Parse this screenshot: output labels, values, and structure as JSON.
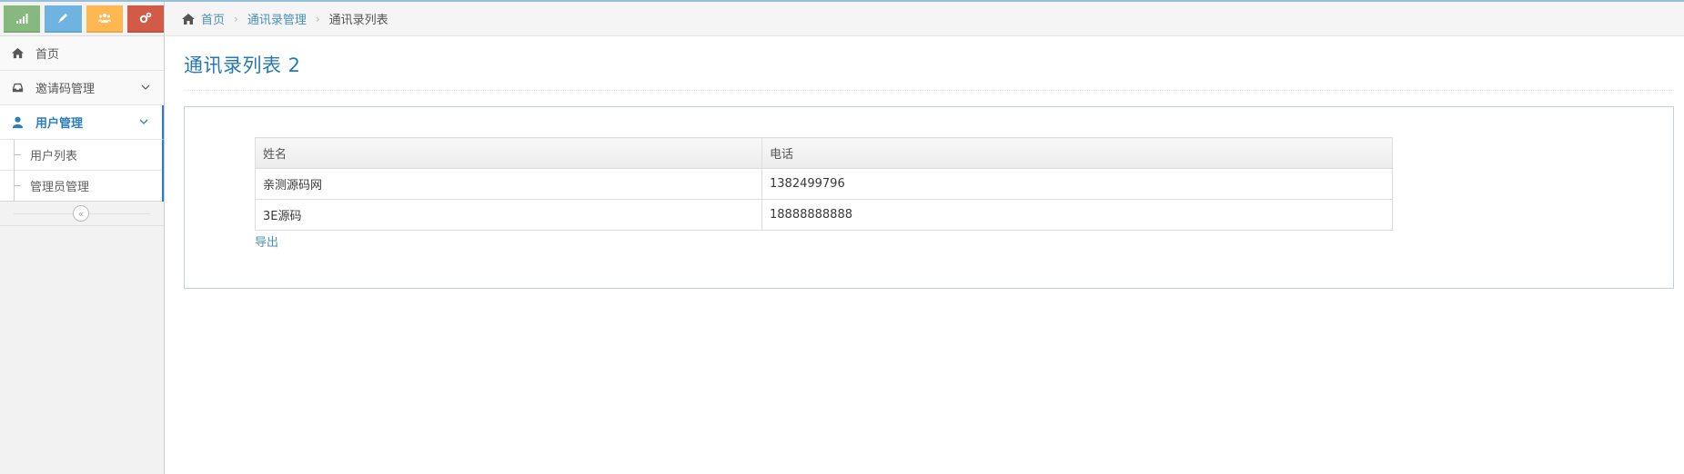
{
  "colors": {
    "accent": "#2679b5",
    "link": "#4c8fbd",
    "shortcut_green": "#87b87f",
    "shortcut_blue": "#6fb3e0",
    "shortcut_orange": "#ffb752",
    "shortcut_red": "#d15b47"
  },
  "shortcuts": [
    {
      "icon": "signal-icon",
      "color": "#87b87f"
    },
    {
      "icon": "pencil-icon",
      "color": "#6fb3e0"
    },
    {
      "icon": "group-icon",
      "color": "#ffb752"
    },
    {
      "icon": "cogs-icon",
      "color": "#d15b47"
    }
  ],
  "sidebar": {
    "items": [
      {
        "label": "首页",
        "icon": "home-icon"
      },
      {
        "label": "邀请码管理",
        "icon": "inbox-icon"
      },
      {
        "label": "用户管理",
        "icon": "user-icon",
        "active": true
      }
    ],
    "submenu": [
      {
        "label": "用户列表"
      },
      {
        "label": "管理员管理"
      }
    ],
    "collapse_symbol": "«"
  },
  "breadcrumb": {
    "home": "首页",
    "section": "通讯录管理",
    "current": "通讯录列表"
  },
  "page": {
    "title": "通讯录列表 2"
  },
  "table": {
    "headers": [
      "姓名",
      "电话"
    ],
    "rows": [
      [
        "亲测源码网",
        "1382499796"
      ],
      [
        "3E源码",
        "18888888888"
      ]
    ]
  },
  "export_label": "导出"
}
